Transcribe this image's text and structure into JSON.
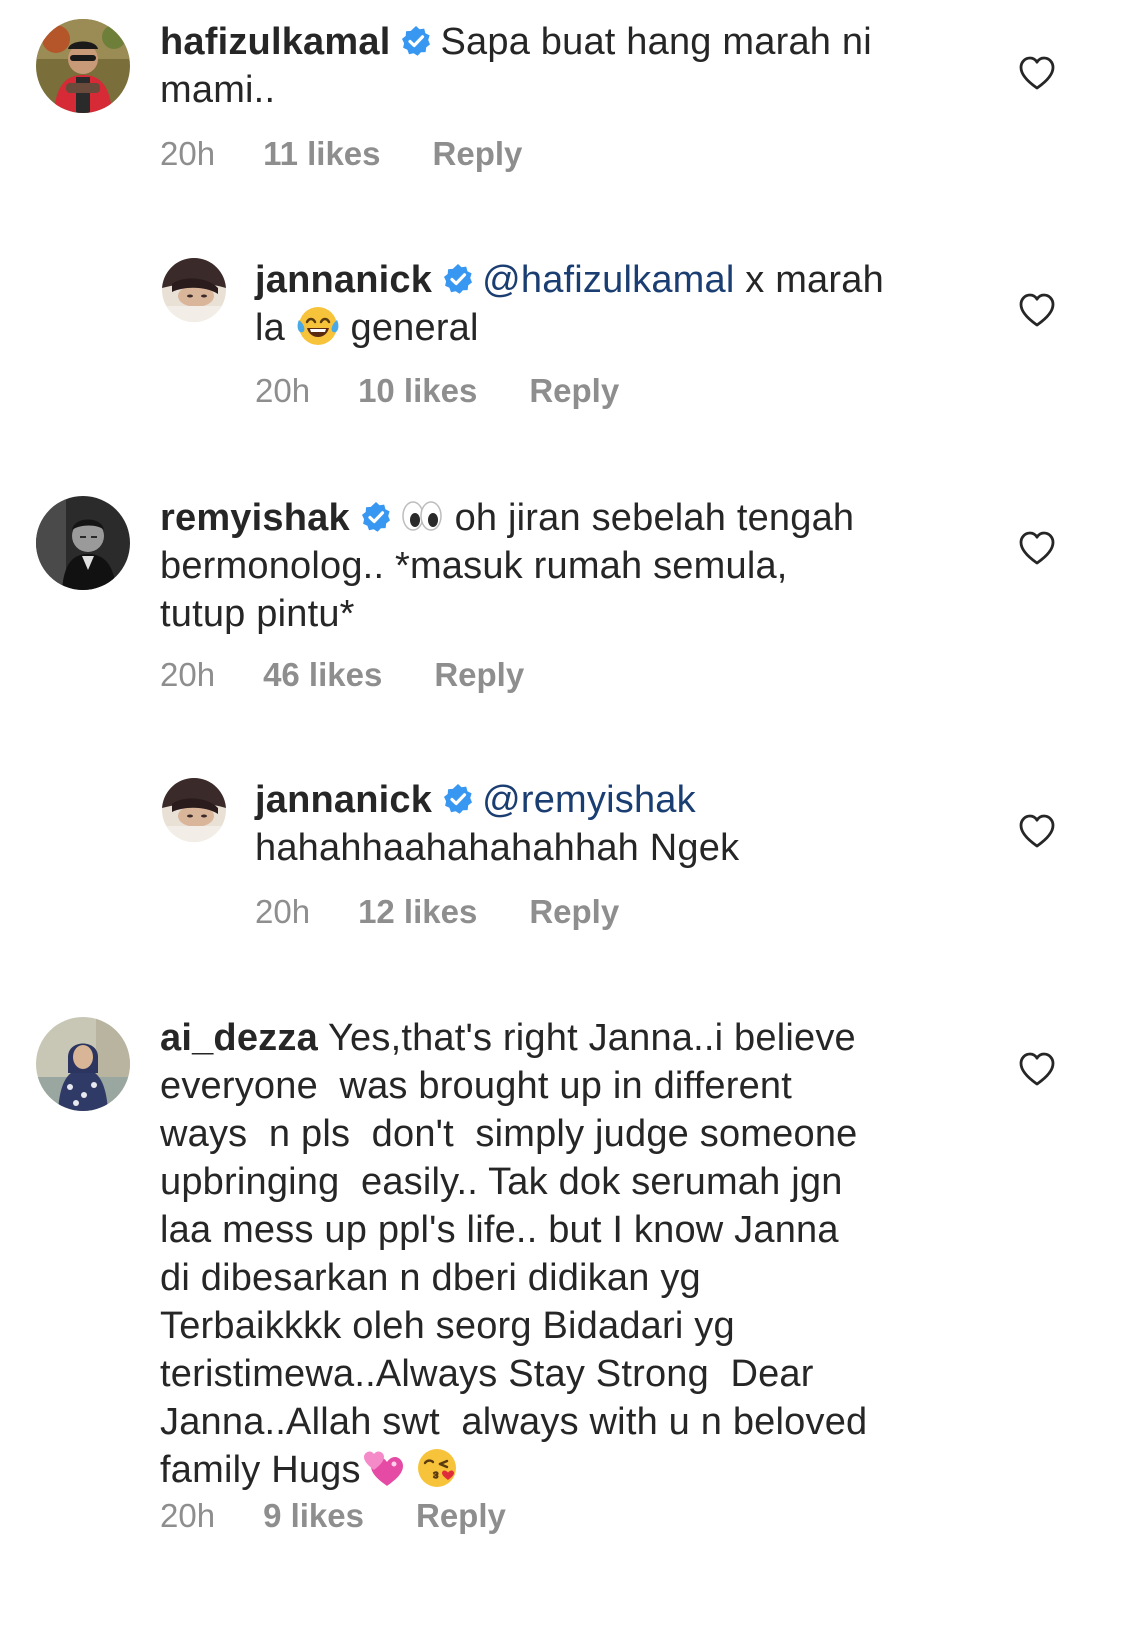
{
  "comments": [
    {
      "username": "hafizulkamal",
      "verified": true,
      "avatar": "avatar-man-red-jacket",
      "lines": [
        "Sapa buat hang marah ni",
        "mami.."
      ],
      "time": "20h",
      "likes": "11 likes",
      "reply_label": "Reply"
    },
    {
      "username": "jannanick",
      "verified": true,
      "avatar": "avatar-woman-lying",
      "mention": "@hafizulkamal",
      "text_after_mention": " x marah",
      "line2_before_emoji": "la ",
      "emoji": "face-with-tears-of-joy",
      "line2_after_emoji": " general",
      "time": "20h",
      "likes": "10 likes",
      "reply_label": "Reply"
    },
    {
      "username": "remyishak",
      "verified": true,
      "avatar": "avatar-man-bw",
      "emoji": "eyes",
      "line1_text": " oh jiran sebelah tengah",
      "lines_rest": [
        "bermonolog.. *masuk rumah semula,",
        "tutup pintu*"
      ],
      "time": "20h",
      "likes": "46 likes",
      "reply_label": "Reply"
    },
    {
      "username": "jannanick",
      "verified": true,
      "avatar": "avatar-woman-lying",
      "mention": "@remyishak",
      "line2": "hahahhaahahahahhah Ngek",
      "time": "20h",
      "likes": "12 likes",
      "reply_label": "Reply"
    },
    {
      "username": "ai_dezza",
      "verified": false,
      "avatar": "avatar-woman-hijab",
      "line1_text": " Yes,that's right Janna..i believe",
      "lines_rest": [
        "everyone  was brought up in different",
        "ways  n pls  don't  simply judge someone",
        "upbringing  easily.. Tak dok serumah jgn",
        "laa mess up ppl's life.. but I know Janna",
        "di dibesarkan n dberi didikan yg",
        "Terbaikkkk oleh seorg Bidadari yg",
        "teristimewa..Always Stay Strong  Dear",
        "Janna..Allah swt  always with u n beloved"
      ],
      "last_line_text": "family Hugs",
      "last_line_emojis": [
        "two-hearts",
        "face-blowing-a-kiss"
      ],
      "time": "20h",
      "likes": "9 likes",
      "reply_label": "Reply"
    }
  ],
  "icons": {
    "like": "heart-outline-icon",
    "verified": "verified-badge-icon"
  },
  "colors": {
    "text": "#262626",
    "meta": "#8e8e8e",
    "mention": "#1b3e72",
    "verified": "#3897f0"
  }
}
